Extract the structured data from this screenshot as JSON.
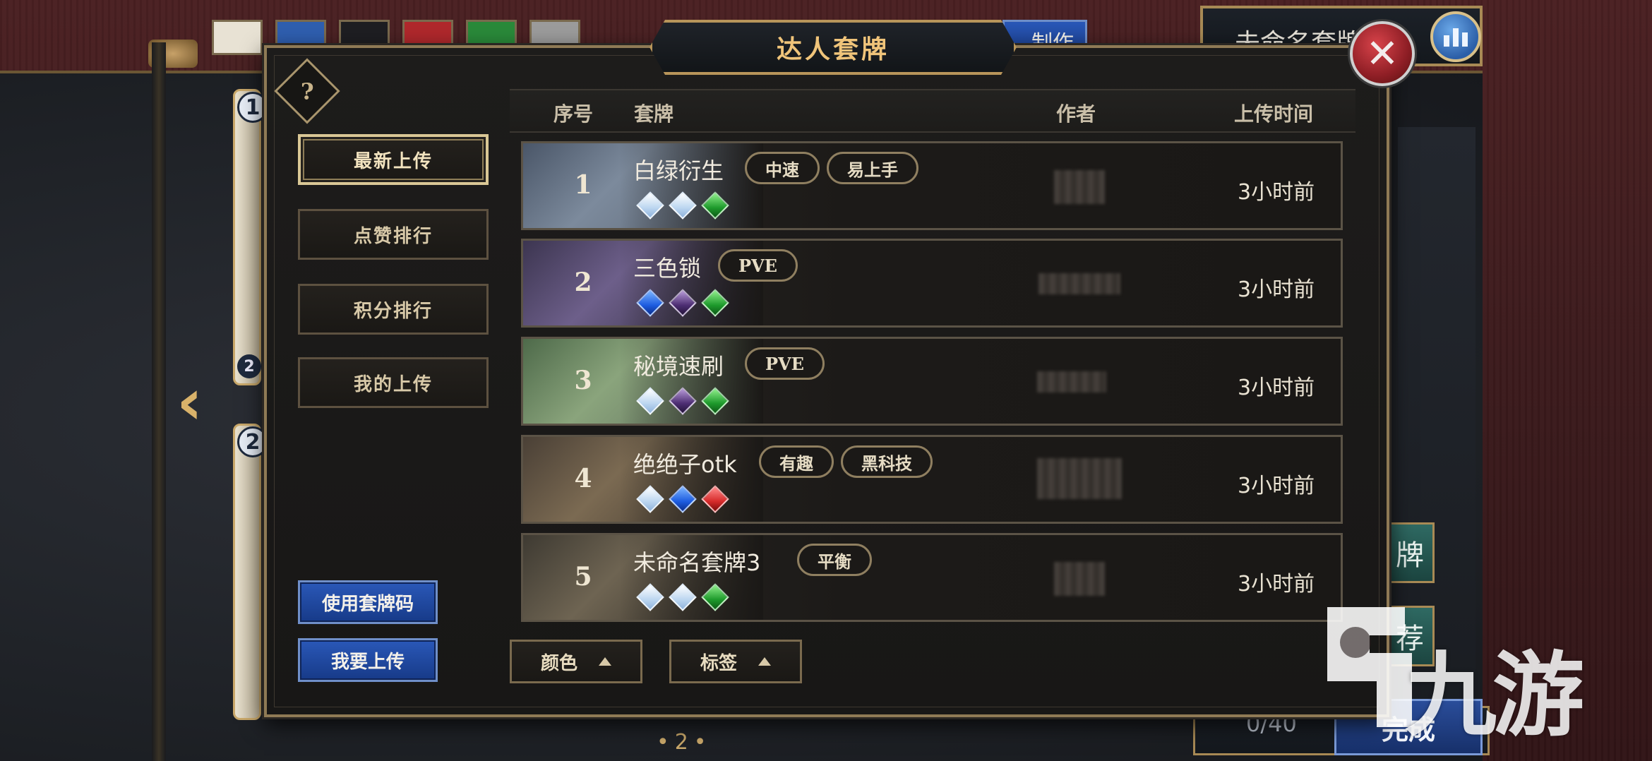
{
  "modal": {
    "title": "达人套牌",
    "close_label": "✕",
    "help_label": "?"
  },
  "sidebar": {
    "items": [
      {
        "label": "最新上传",
        "active": true
      },
      {
        "label": "点赞排行",
        "active": false
      },
      {
        "label": "积分排行",
        "active": false
      },
      {
        "label": "我的上传",
        "active": false
      }
    ],
    "use_code_label": "使用套牌码",
    "upload_label": "我要上传"
  },
  "table": {
    "headers": {
      "index": "序号",
      "deck": "套牌",
      "author": "作者",
      "time": "上传时间"
    },
    "rows": [
      {
        "index": "1",
        "name": "白绿衍生",
        "tags": [
          "中速",
          "易上手"
        ],
        "gems": [
          "white",
          "white",
          "green"
        ],
        "time": "3小时前"
      },
      {
        "index": "2",
        "name": "三色锁",
        "tags": [
          "PVE"
        ],
        "gems": [
          "blue",
          "purple",
          "green"
        ],
        "time": "3小时前"
      },
      {
        "index": "3",
        "name": "秘境速刷",
        "tags": [
          "PVE"
        ],
        "gems": [
          "white",
          "purple",
          "green"
        ],
        "time": "3小时前"
      },
      {
        "index": "4",
        "name": "绝绝子otk",
        "tags": [
          "有趣",
          "黑科技"
        ],
        "gems": [
          "white",
          "blue",
          "red"
        ],
        "time": "3小时前"
      },
      {
        "index": "5",
        "name": "未命名套牌3",
        "tags": [
          "平衡"
        ],
        "gems": [
          "white",
          "white",
          "green"
        ],
        "time": "3小时前"
      }
    ]
  },
  "filters": {
    "color_label": "颜色",
    "tag_label": "标签"
  },
  "background": {
    "deck_name": "未命名套牌",
    "craft_label": "制作",
    "card_count": "0/40",
    "done_label": "完成",
    "side_btn_1": "牌",
    "side_btn_2": "荐",
    "page_number": "•2•",
    "badge_1": "1",
    "badge_2": "2",
    "badge_3": "2"
  },
  "watermark": {
    "text": "九游"
  },
  "colors": {
    "accent_gold": "#d9c795",
    "title_gold": "#f0c47a",
    "panel_bg": "#1d1c1b",
    "blue_button": "#2a58b8",
    "close_red": "#8e1e25"
  }
}
